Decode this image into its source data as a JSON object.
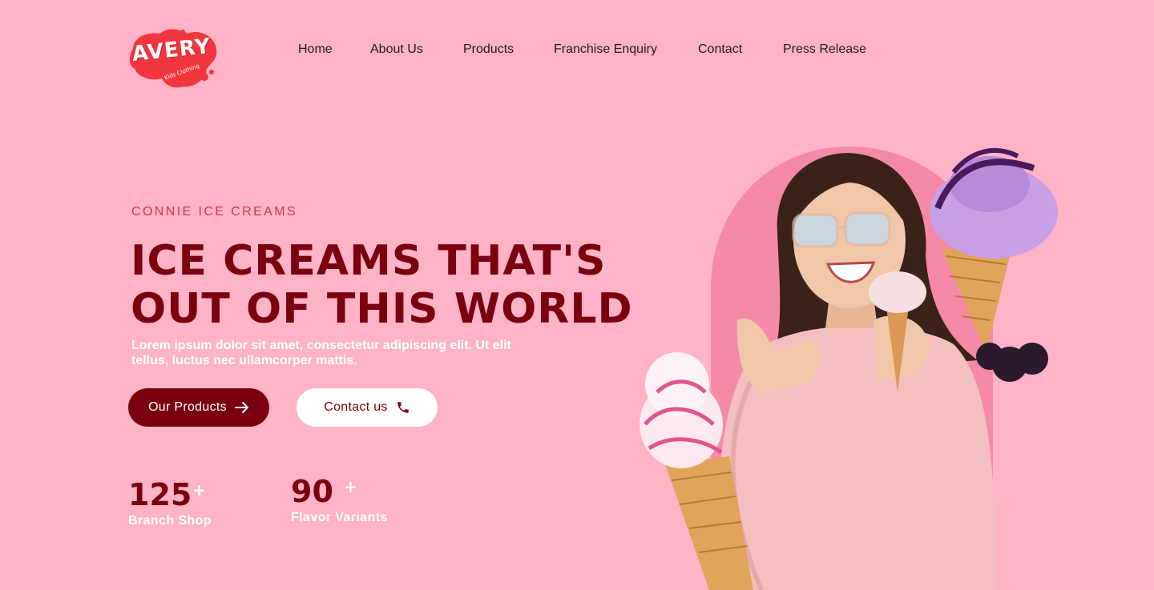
{
  "brand": {
    "logo_text": "AVERY",
    "logo_sub": "Kids Clothing",
    "color": "#f2363f"
  },
  "nav": {
    "items": [
      {
        "label": "Home"
      },
      {
        "label": "About Us"
      },
      {
        "label": "Products"
      },
      {
        "label": "Franchise Enquiry"
      },
      {
        "label": "Contact"
      },
      {
        "label": "Press Release"
      }
    ]
  },
  "hero": {
    "eyebrow": "CONNIE ICE CREAMS",
    "headline_line1": "ICE CREAMS THAT'S",
    "headline_line2": "OUT OF THIS WORLD",
    "lead": "Lorem ipsum dolor sit amet, consectetur adipiscing elit. Ut elit tellus, luctus nec ullamcorper mattis.",
    "primary_button": {
      "label": "Our Products",
      "icon": "arrow-right-icon"
    },
    "secondary_button": {
      "label": "Contact us",
      "icon": "phone-icon"
    },
    "illustration": "woman-with-ice-cream-cones"
  },
  "stats": [
    {
      "value": "125",
      "suffix": "+",
      "label": "Branch Shop"
    },
    {
      "value": "90",
      "suffix": "+",
      "label": "Flavor Variants"
    }
  ],
  "colors": {
    "background": "#ffb3c6",
    "accent": "#7a0010",
    "eyebrow": "#d0374f",
    "arch": "#f58aa8"
  }
}
